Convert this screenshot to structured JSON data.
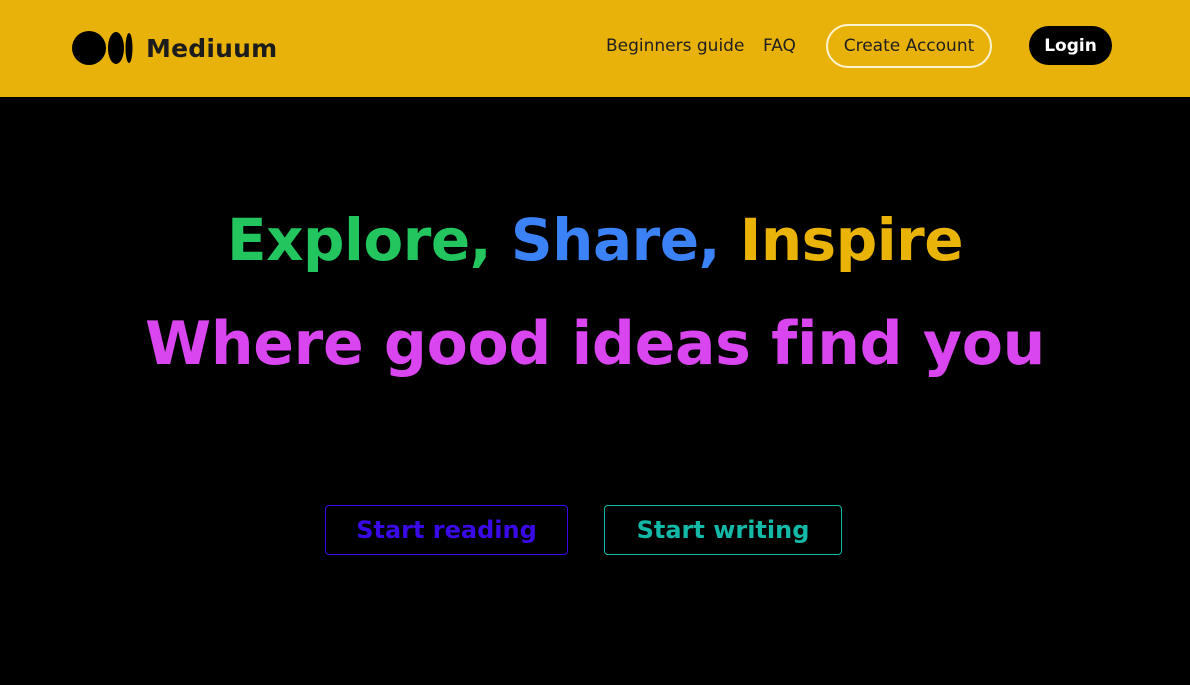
{
  "header": {
    "brand": "Mediuum",
    "nav": {
      "beginners_guide": "Beginners guide",
      "faq": "FAQ",
      "create_account": "Create Account",
      "login": "Login"
    }
  },
  "hero": {
    "explore": "Explore,",
    "share": "Share,",
    "inspire": "Inspire",
    "tagline": "Where good ideas find you",
    "start_reading": "Start reading",
    "start_writing": "Start writing"
  },
  "colors": {
    "header_bg": "#e8b20b",
    "page_bg": "#000000",
    "explore": "#22c55e",
    "share": "#3b82f6",
    "inspire": "#eab308",
    "tagline": "#d946ef",
    "start_reading": "#3a0ae6",
    "start_writing": "#14b8a6"
  },
  "icons": {
    "logo": "medium-logo-icon"
  }
}
